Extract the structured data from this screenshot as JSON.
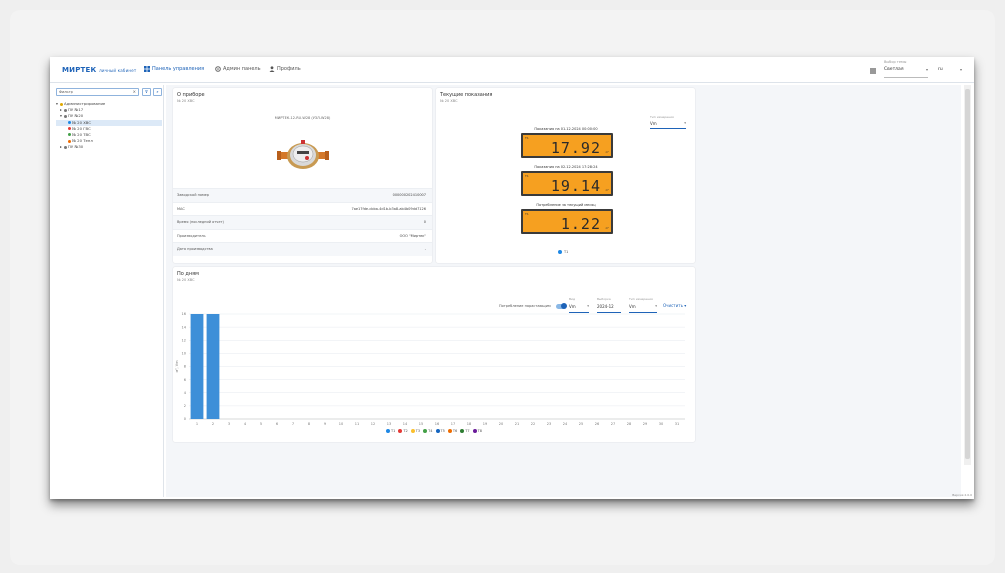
{
  "app": {
    "logo": "МИРТЕК",
    "logo_sub": "личный кабинет",
    "nav": {
      "panel": "Панель управления",
      "admin": "Админ панель",
      "profile": "Профиль"
    },
    "theme": {
      "label": "Выбор темы",
      "value": "Светлая"
    },
    "lang": {
      "value": "ru"
    }
  },
  "sidebar": {
    "search_placeholder": "Фильтр",
    "search_clear": "×",
    "filter_btn": "⊽",
    "search_btn": "⌕",
    "tree": [
      {
        "label": "Администрирование",
        "indent": 0,
        "caret": "▾",
        "icon": "folder"
      },
      {
        "label": "ПУ №17",
        "indent": 1,
        "caret": "▸",
        "icon": "meter"
      },
      {
        "label": "ПУ №20",
        "indent": 1,
        "caret": "▾",
        "icon": "meter"
      },
      {
        "label": "№ 20 ХВС",
        "indent": 2,
        "caret": "",
        "icon": "drop-blue",
        "selected": true
      },
      {
        "label": "№ 20 ГВС",
        "indent": 2,
        "caret": "",
        "icon": "drop-red"
      },
      {
        "label": "№ 20 ТВС",
        "indent": 2,
        "caret": "",
        "icon": "drop-green"
      },
      {
        "label": "№ 20 Тепл",
        "indent": 2,
        "caret": "",
        "icon": "flame"
      },
      {
        "label": "ПУ №30",
        "indent": 1,
        "caret": "▸",
        "icon": "meter"
      }
    ]
  },
  "device_card": {
    "title": "О приборе",
    "subtitle": "№ 20 ХВС",
    "device_name": "МИРТЕК-12-RU-W28 (УЗЛ-W28)",
    "rows": [
      {
        "key": "Заводской номер",
        "value": "000000202410007"
      },
      {
        "key": "MAC",
        "value": "7ae17fde-cbba-4d1b-b3a8-ab4b09dd7126"
      },
      {
        "key": "Время (последний отчет)",
        "value": "0"
      },
      {
        "key": "Производитель",
        "value": "ООО \"Миртек\""
      },
      {
        "key": "Дата производства",
        "value": "-"
      }
    ]
  },
  "readings_card": {
    "title": "Текущие показания",
    "subtitle": "№ 20 ХВС",
    "tariff": {
      "label": "Тип измерения",
      "value": "Vm"
    },
    "displays": [
      {
        "caption": "Показания на 01.12.2024 00:00:00",
        "tag": "T1",
        "value": "17.92",
        "unit": "m³"
      },
      {
        "caption": "Показания на 02.12.2024 17:28:24",
        "tag": "T1",
        "value": "19.14",
        "unit": "m³"
      },
      {
        "caption": "Потребление за текущий месяц",
        "tag": "T1",
        "value": "1.22",
        "unit": "m³"
      }
    ],
    "legend": "T1",
    "accent": "#f6a020"
  },
  "chart_card": {
    "title": "По дням",
    "subtitle": "№ 20 ХВС",
    "toggle_label": "Потребление нарастающим",
    "controls": [
      {
        "label": "Вид",
        "value": "Vm"
      },
      {
        "label": "Выборка",
        "value": "2024-12"
      },
      {
        "label": "Тип измерения",
        "value": "Vm"
      }
    ],
    "reset": "Очистить",
    "legend": [
      {
        "name": "T1",
        "color": "#1e88e5"
      },
      {
        "name": "T2",
        "color": "#e53935"
      },
      {
        "name": "T3",
        "color": "#fbc02d"
      },
      {
        "name": "T4",
        "color": "#43a047"
      },
      {
        "name": "T5",
        "color": "#1565c0"
      },
      {
        "name": "T6",
        "color": "#ef6c00"
      },
      {
        "name": "T7",
        "color": "#2e7d32"
      },
      {
        "name": "T8",
        "color": "#6a1b9a"
      }
    ]
  },
  "chart_data": {
    "type": "bar",
    "categories": [
      "1",
      "2",
      "3",
      "4",
      "5",
      "6",
      "7",
      "8",
      "9",
      "10",
      "11",
      "12",
      "13",
      "14",
      "15",
      "16",
      "17",
      "18",
      "19",
      "20",
      "21",
      "22",
      "23",
      "24",
      "25",
      "26",
      "27",
      "28",
      "29",
      "30",
      "31"
    ],
    "series": [
      {
        "name": "T1",
        "values": [
          16,
          16,
          0,
          0,
          0,
          0,
          0,
          0,
          0,
          0,
          0,
          0,
          0,
          0,
          0,
          0,
          0,
          0,
          0,
          0,
          0,
          0,
          0,
          0,
          0,
          0,
          0,
          0,
          0,
          0,
          0
        ]
      }
    ],
    "yticks": [
      "0",
      "2",
      "4",
      "6",
      "8",
      "10",
      "12",
      "14",
      "16"
    ],
    "ylabel": "м³, Vm",
    "ylim": [
      0,
      16
    ],
    "grid": true,
    "legend_position": "bottom",
    "bar_color": "#3d8fd8"
  },
  "footer": {
    "corner": "Версия 2.0.0"
  }
}
